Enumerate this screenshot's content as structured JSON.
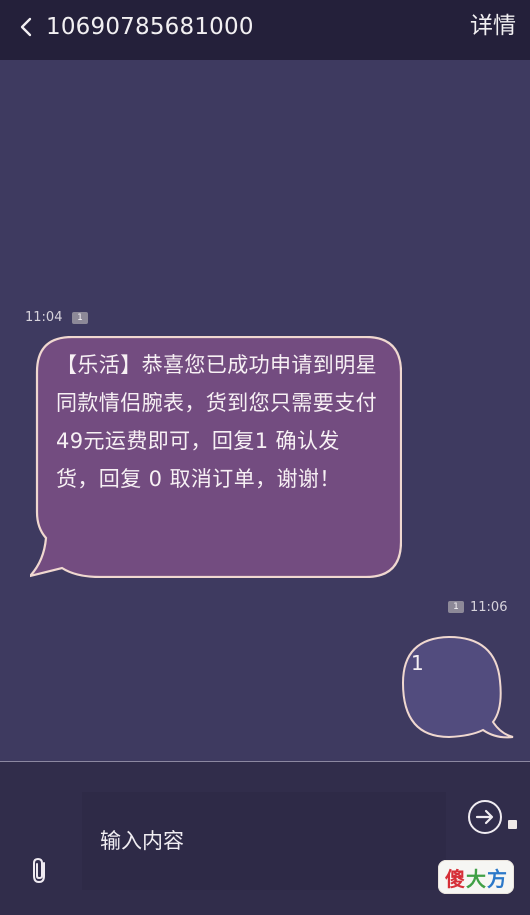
{
  "header": {
    "title": "10690785681000",
    "details_label": "详情"
  },
  "messages": [
    {
      "direction": "incoming",
      "time": "11:04",
      "sim": "1",
      "text": "【乐活】恭喜您已成功申请到明星同款情侣腕表，货到您只需要支付49元运费即可，回复1 确认发货，回复 0 取消订单，谢谢！"
    },
    {
      "direction": "outgoing",
      "time": "11:06",
      "sim": "1",
      "text": "1"
    }
  ],
  "composer": {
    "placeholder": "输入内容"
  },
  "watermark": {
    "chars": [
      "傻",
      "大",
      "方"
    ]
  },
  "colors": {
    "header": "#24203a",
    "background": "#3e3a60",
    "incoming_bubble": "#734c80",
    "bubble_border": "#f0d8d0",
    "composer": "#312d4b"
  },
  "icons": {
    "back": "back-icon",
    "attachment": "paperclip-icon",
    "send": "send-icon"
  }
}
